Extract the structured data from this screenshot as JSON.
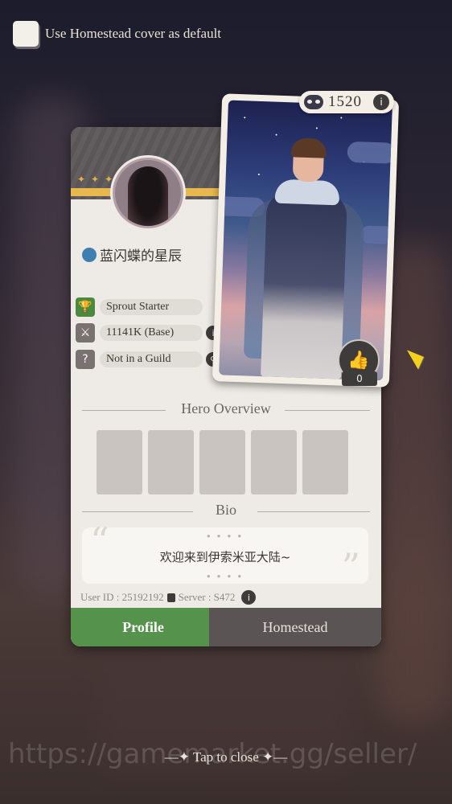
{
  "top_option": {
    "label": "Use Homestead cover as default",
    "checked": false
  },
  "profile": {
    "player_name": "蓝闪蝶的星辰",
    "stats": {
      "title": "Sprout Starter",
      "power": "11141K (Base)",
      "guild": "Not in a Guild"
    },
    "hero_overview_title": "Hero Overview",
    "hero_slots": 5,
    "bio_title": "Bio",
    "bio_text": "欢迎来到伊索米亚大陆~",
    "user_id_label": "User ID : 25192192",
    "server_label": "Server : S472"
  },
  "portrait_card": {
    "score": "1520",
    "likes": "0"
  },
  "tabs": [
    {
      "label": "Profile",
      "active": true
    },
    {
      "label": "Homestead",
      "active": false
    }
  ],
  "close_hint": "Tap to close",
  "watermark": "https://gamemarket.gg/seller/",
  "icons": [
    "checkbox-icon",
    "mask-icon",
    "info-icon",
    "thumbs-up-icon",
    "trophy-icon",
    "power-icon",
    "question-icon",
    "search-icon",
    "copy-icon",
    "cursor-icon"
  ],
  "colors": {
    "accent_green": "#55924c",
    "tab_dark": "#5b5455",
    "gold": "#e7b94d"
  }
}
